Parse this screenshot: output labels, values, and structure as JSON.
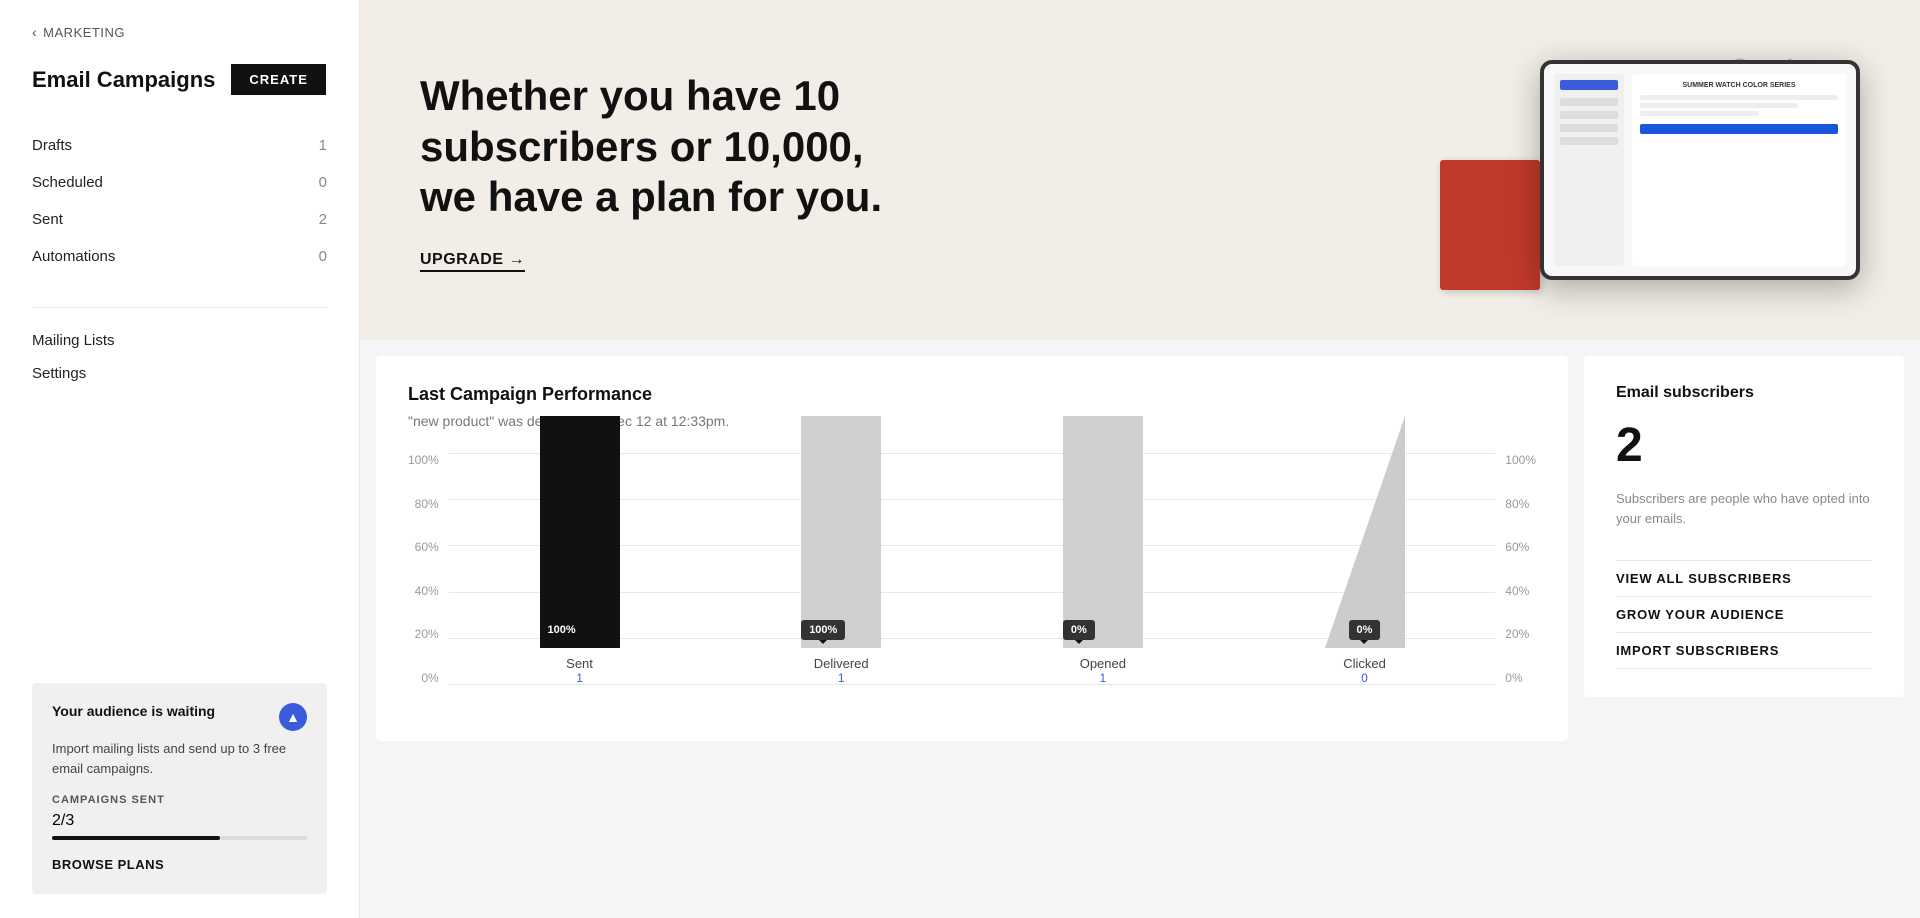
{
  "back": {
    "label": "MARKETING",
    "arrow": "‹"
  },
  "sidebar": {
    "title": "Email Campaigns",
    "create_button": "CREATE",
    "nav_items": [
      {
        "label": "Drafts",
        "count": "1"
      },
      {
        "label": "Scheduled",
        "count": "0"
      },
      {
        "label": "Sent",
        "count": "2"
      },
      {
        "label": "Automations",
        "count": "0"
      }
    ],
    "section_links": [
      {
        "label": "Mailing Lists"
      },
      {
        "label": "Settings"
      }
    ]
  },
  "promo_card": {
    "title": "Your audience is waiting",
    "icon": "▲",
    "text": "Import mailing lists and send up to 3 free email campaigns.",
    "campaigns_sent_label": "CAMPAIGNS SENT",
    "campaigns_value": "2/3",
    "progress_pct": 66,
    "browse_plans": "BROWSE PLANS"
  },
  "hero": {
    "headline": "Whether you have 10 subscribers or 10,000, we have a plan for you.",
    "upgrade_link": "UPGRADE →"
  },
  "performance": {
    "title": "Last Campaign Performance",
    "subtitle": "\"new product\" was delivered on Dec 12 at 12:33pm.",
    "y_labels_left": [
      "100%",
      "80%",
      "60%",
      "40%",
      "20%",
      "0%"
    ],
    "y_labels_right": [
      "100%",
      "80%",
      "60%",
      "40%",
      "20%",
      "0%"
    ],
    "bars": [
      {
        "label": "Sent",
        "sublabel": "1",
        "pct": 100,
        "tooltip": "100%",
        "dark": true
      },
      {
        "label": "Delivered",
        "sublabel": "1",
        "pct": 100,
        "tooltip": "100%",
        "dark": true
      },
      {
        "label": "Opened",
        "sublabel": "1",
        "pct": 100,
        "tooltip": "0%",
        "dark": true
      },
      {
        "label": "Clicked",
        "sublabel": "0",
        "pct": 0,
        "tooltip": "0%",
        "dark": false,
        "triangle": true
      }
    ]
  },
  "subscribers": {
    "title": "Email subscribers",
    "count": "2",
    "description": "Subscribers are people who have opted into your emails.",
    "links": [
      {
        "label": "VIEW ALL SUBSCRIBERS"
      },
      {
        "label": "GROW YOUR AUDIENCE"
      },
      {
        "label": "IMPORT SUBSCRIBERS"
      }
    ]
  }
}
